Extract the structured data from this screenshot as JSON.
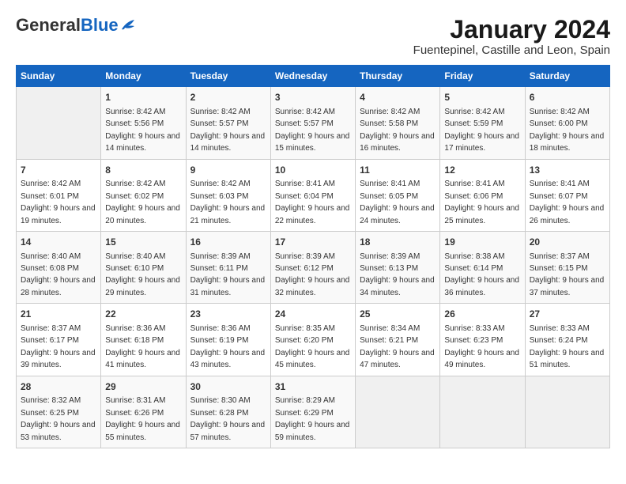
{
  "header": {
    "logo_general": "General",
    "logo_blue": "Blue",
    "title": "January 2024",
    "subtitle": "Fuentepinel, Castille and Leon, Spain"
  },
  "calendar": {
    "weekdays": [
      "Sunday",
      "Monday",
      "Tuesday",
      "Wednesday",
      "Thursday",
      "Friday",
      "Saturday"
    ],
    "weeks": [
      [
        {
          "day": "",
          "empty": true
        },
        {
          "day": "1",
          "sunrise": "Sunrise: 8:42 AM",
          "sunset": "Sunset: 5:56 PM",
          "daylight": "Daylight: 9 hours and 14 minutes."
        },
        {
          "day": "2",
          "sunrise": "Sunrise: 8:42 AM",
          "sunset": "Sunset: 5:57 PM",
          "daylight": "Daylight: 9 hours and 14 minutes."
        },
        {
          "day": "3",
          "sunrise": "Sunrise: 8:42 AM",
          "sunset": "Sunset: 5:57 PM",
          "daylight": "Daylight: 9 hours and 15 minutes."
        },
        {
          "day": "4",
          "sunrise": "Sunrise: 8:42 AM",
          "sunset": "Sunset: 5:58 PM",
          "daylight": "Daylight: 9 hours and 16 minutes."
        },
        {
          "day": "5",
          "sunrise": "Sunrise: 8:42 AM",
          "sunset": "Sunset: 5:59 PM",
          "daylight": "Daylight: 9 hours and 17 minutes."
        },
        {
          "day": "6",
          "sunrise": "Sunrise: 8:42 AM",
          "sunset": "Sunset: 6:00 PM",
          "daylight": "Daylight: 9 hours and 18 minutes."
        }
      ],
      [
        {
          "day": "7",
          "sunrise": "Sunrise: 8:42 AM",
          "sunset": "Sunset: 6:01 PM",
          "daylight": "Daylight: 9 hours and 19 minutes."
        },
        {
          "day": "8",
          "sunrise": "Sunrise: 8:42 AM",
          "sunset": "Sunset: 6:02 PM",
          "daylight": "Daylight: 9 hours and 20 minutes."
        },
        {
          "day": "9",
          "sunrise": "Sunrise: 8:42 AM",
          "sunset": "Sunset: 6:03 PM",
          "daylight": "Daylight: 9 hours and 21 minutes."
        },
        {
          "day": "10",
          "sunrise": "Sunrise: 8:41 AM",
          "sunset": "Sunset: 6:04 PM",
          "daylight": "Daylight: 9 hours and 22 minutes."
        },
        {
          "day": "11",
          "sunrise": "Sunrise: 8:41 AM",
          "sunset": "Sunset: 6:05 PM",
          "daylight": "Daylight: 9 hours and 24 minutes."
        },
        {
          "day": "12",
          "sunrise": "Sunrise: 8:41 AM",
          "sunset": "Sunset: 6:06 PM",
          "daylight": "Daylight: 9 hours and 25 minutes."
        },
        {
          "day": "13",
          "sunrise": "Sunrise: 8:41 AM",
          "sunset": "Sunset: 6:07 PM",
          "daylight": "Daylight: 9 hours and 26 minutes."
        }
      ],
      [
        {
          "day": "14",
          "sunrise": "Sunrise: 8:40 AM",
          "sunset": "Sunset: 6:08 PM",
          "daylight": "Daylight: 9 hours and 28 minutes."
        },
        {
          "day": "15",
          "sunrise": "Sunrise: 8:40 AM",
          "sunset": "Sunset: 6:10 PM",
          "daylight": "Daylight: 9 hours and 29 minutes."
        },
        {
          "day": "16",
          "sunrise": "Sunrise: 8:39 AM",
          "sunset": "Sunset: 6:11 PM",
          "daylight": "Daylight: 9 hours and 31 minutes."
        },
        {
          "day": "17",
          "sunrise": "Sunrise: 8:39 AM",
          "sunset": "Sunset: 6:12 PM",
          "daylight": "Daylight: 9 hours and 32 minutes."
        },
        {
          "day": "18",
          "sunrise": "Sunrise: 8:39 AM",
          "sunset": "Sunset: 6:13 PM",
          "daylight": "Daylight: 9 hours and 34 minutes."
        },
        {
          "day": "19",
          "sunrise": "Sunrise: 8:38 AM",
          "sunset": "Sunset: 6:14 PM",
          "daylight": "Daylight: 9 hours and 36 minutes."
        },
        {
          "day": "20",
          "sunrise": "Sunrise: 8:37 AM",
          "sunset": "Sunset: 6:15 PM",
          "daylight": "Daylight: 9 hours and 37 minutes."
        }
      ],
      [
        {
          "day": "21",
          "sunrise": "Sunrise: 8:37 AM",
          "sunset": "Sunset: 6:17 PM",
          "daylight": "Daylight: 9 hours and 39 minutes."
        },
        {
          "day": "22",
          "sunrise": "Sunrise: 8:36 AM",
          "sunset": "Sunset: 6:18 PM",
          "daylight": "Daylight: 9 hours and 41 minutes."
        },
        {
          "day": "23",
          "sunrise": "Sunrise: 8:36 AM",
          "sunset": "Sunset: 6:19 PM",
          "daylight": "Daylight: 9 hours and 43 minutes."
        },
        {
          "day": "24",
          "sunrise": "Sunrise: 8:35 AM",
          "sunset": "Sunset: 6:20 PM",
          "daylight": "Daylight: 9 hours and 45 minutes."
        },
        {
          "day": "25",
          "sunrise": "Sunrise: 8:34 AM",
          "sunset": "Sunset: 6:21 PM",
          "daylight": "Daylight: 9 hours and 47 minutes."
        },
        {
          "day": "26",
          "sunrise": "Sunrise: 8:33 AM",
          "sunset": "Sunset: 6:23 PM",
          "daylight": "Daylight: 9 hours and 49 minutes."
        },
        {
          "day": "27",
          "sunrise": "Sunrise: 8:33 AM",
          "sunset": "Sunset: 6:24 PM",
          "daylight": "Daylight: 9 hours and 51 minutes."
        }
      ],
      [
        {
          "day": "28",
          "sunrise": "Sunrise: 8:32 AM",
          "sunset": "Sunset: 6:25 PM",
          "daylight": "Daylight: 9 hours and 53 minutes."
        },
        {
          "day": "29",
          "sunrise": "Sunrise: 8:31 AM",
          "sunset": "Sunset: 6:26 PM",
          "daylight": "Daylight: 9 hours and 55 minutes."
        },
        {
          "day": "30",
          "sunrise": "Sunrise: 8:30 AM",
          "sunset": "Sunset: 6:28 PM",
          "daylight": "Daylight: 9 hours and 57 minutes."
        },
        {
          "day": "31",
          "sunrise": "Sunrise: 8:29 AM",
          "sunset": "Sunset: 6:29 PM",
          "daylight": "Daylight: 9 hours and 59 minutes."
        },
        {
          "day": "",
          "empty": true
        },
        {
          "day": "",
          "empty": true
        },
        {
          "day": "",
          "empty": true
        }
      ]
    ]
  }
}
